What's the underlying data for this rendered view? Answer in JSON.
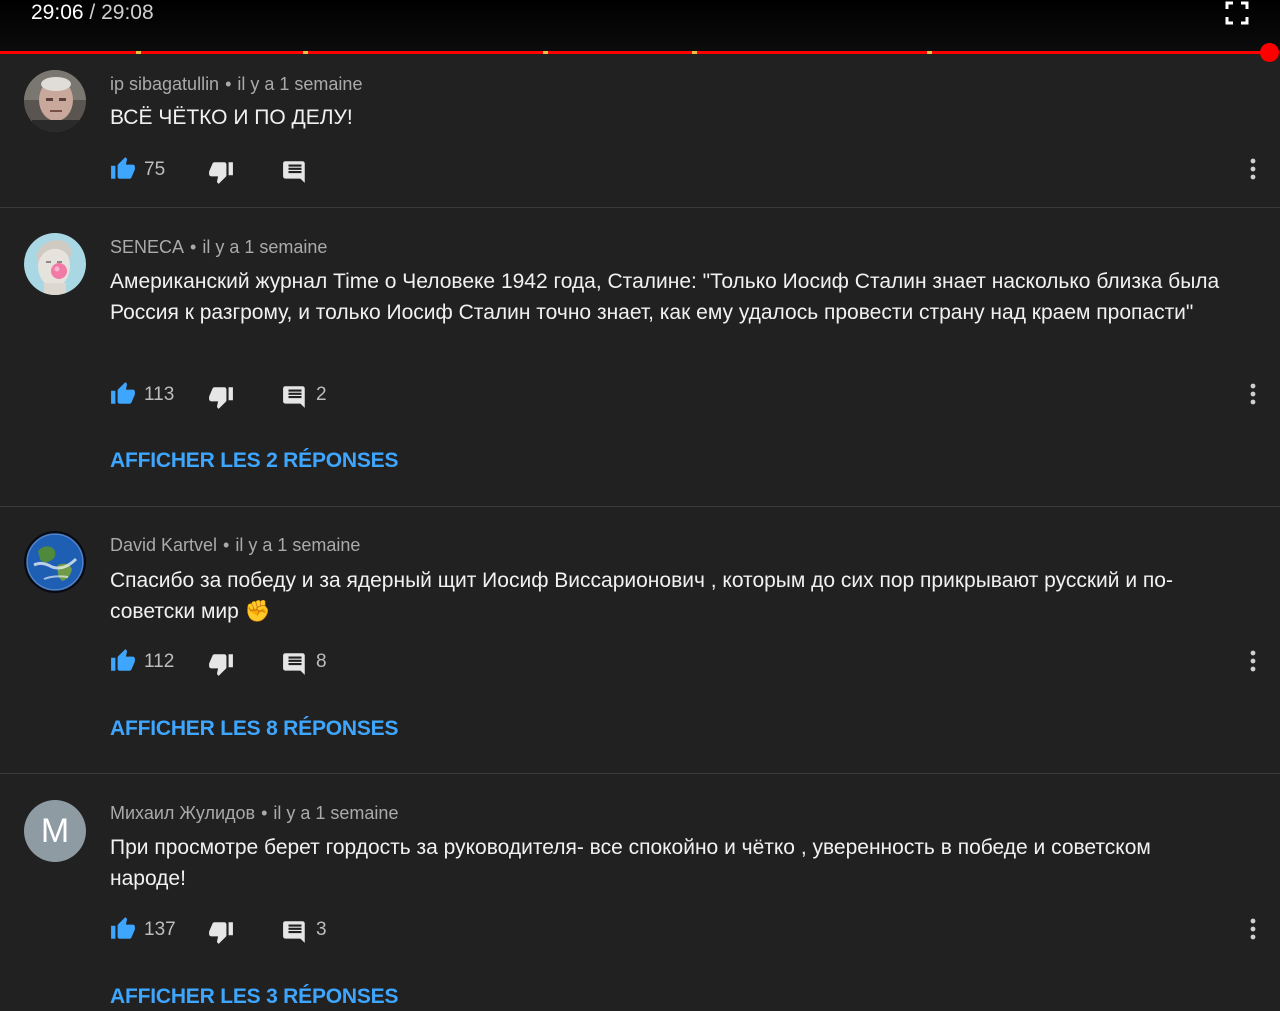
{
  "player": {
    "current_time": "29:06",
    "separator": "/",
    "duration": "29:08",
    "progress_fraction": 0.998,
    "progress_color": "#ff0000",
    "fullscreen_icon": "fullscreen-icon"
  },
  "colors": {
    "background": "#212121",
    "accent_blue": "#3ea6ff",
    "like_blue": "#3ea6ff",
    "meta_gray": "#aaaaaa"
  },
  "comments": [
    {
      "author": "ip sibagatullin",
      "time": "il y a 1 semaine",
      "text": "ВСЁ ЧЁТКО И ПО ДЕЛУ!",
      "likes": "75",
      "reply_count": "",
      "replies_label": "",
      "avatar": "photo-portrait"
    },
    {
      "author": "SENECA",
      "time": "il y a 1 semaine",
      "text": "Американский журнал Time о Человеке 1942 года, Сталине:  \"Только Иосиф Сталин знает насколько близка была Россия к разгрому, и только Иосиф Сталин точно знает, как ему удалось провести страну над краем пропасти\"",
      "likes": "113",
      "reply_count": "2",
      "replies_label": "AFFICHER LES 2 RÉPONSES",
      "avatar": "statue-bubblegum"
    },
    {
      "author": "David Kartvel",
      "time": "il y a 1 semaine",
      "text": "Спасибо за победу и за ядерный щит Иосиф Виссарионович , которым до сих пор прикрывают русский и по-советски мир ✊",
      "likes": "112",
      "reply_count": "8",
      "replies_label": "AFFICHER LES 8 RÉPONSES",
      "avatar": "earth-globe"
    },
    {
      "author": "Михаил Жулидов",
      "time": "il y a 1 semaine",
      "text": "При просмотре берет гордость за руководителя- все спокойно и чётко , уверенность в победе и советском народе!",
      "likes": "137",
      "reply_count": "3",
      "replies_label": "AFFICHER LES 3 RÉPONSES",
      "avatar": "letter",
      "avatar_letter": "M"
    }
  ]
}
